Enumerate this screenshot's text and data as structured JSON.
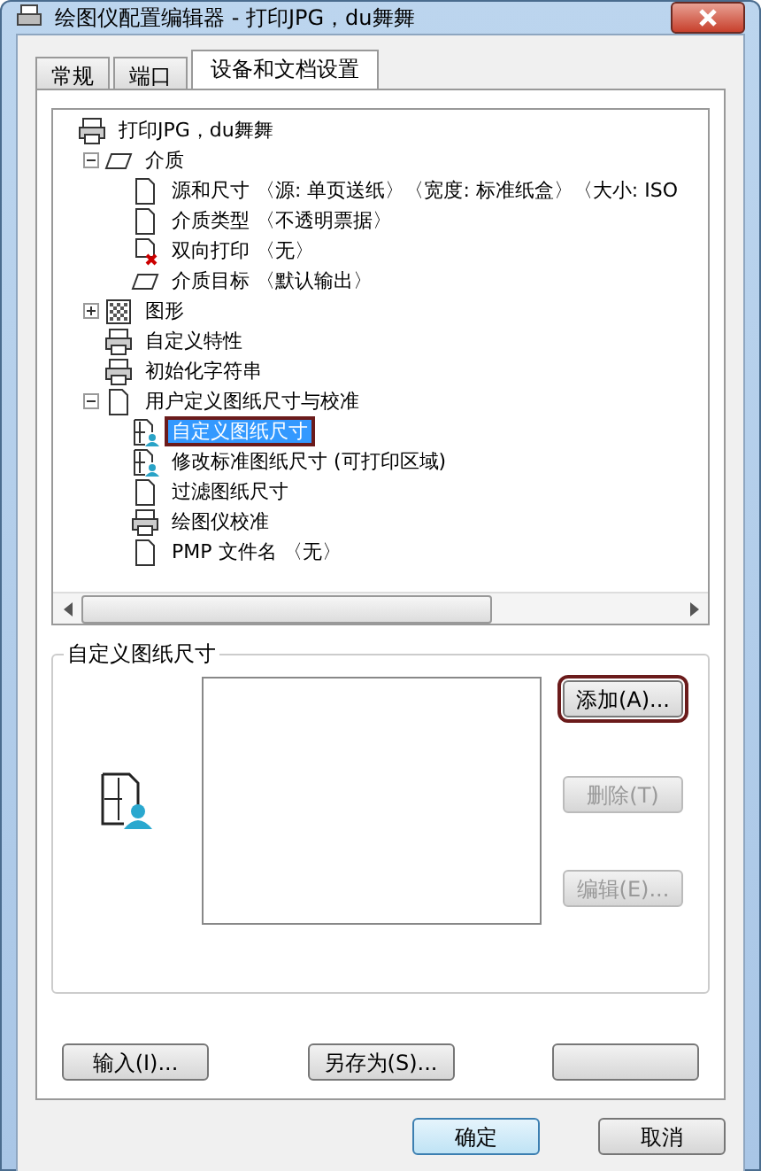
{
  "window": {
    "title": "绘图仪配置编辑器 - 打印JPG，du舞舞"
  },
  "tabs": [
    {
      "label": "常规",
      "selected": false
    },
    {
      "label": "端口",
      "selected": false
    },
    {
      "label": "设备和文档设置",
      "selected": true
    }
  ],
  "tree": [
    {
      "label": "打印JPG，du舞舞",
      "kind": "printer",
      "selected": false,
      "highlighted": false,
      "children": [
        {
          "label": "介质",
          "kind": "sheet",
          "expanded": true,
          "selected": false,
          "highlighted": false,
          "children": [
            {
              "label": "源和尺寸 〈源:  单页送纸〉〈宽度: 标准纸盒〉〈大小: ISO",
              "kind": "page",
              "selected": false,
              "highlighted": false
            },
            {
              "label": "介质类型 〈不透明票据〉",
              "kind": "page",
              "selected": false,
              "highlighted": false
            },
            {
              "label": "双向打印 〈无〉",
              "kind": "duplex",
              "selected": false,
              "highlighted": false
            },
            {
              "label": "介质目标 〈默认输出〉",
              "kind": "sheet",
              "selected": false,
              "highlighted": false
            }
          ]
        },
        {
          "label": "图形",
          "kind": "pattern",
          "expanded": false,
          "selected": false,
          "highlighted": false
        },
        {
          "label": "自定义特性",
          "kind": "printer",
          "selected": false,
          "highlighted": false
        },
        {
          "label": "初始化字符串",
          "kind": "printer",
          "selected": false,
          "highlighted": false
        },
        {
          "label": "用户定义图纸尺寸与校准",
          "kind": "page",
          "expanded": true,
          "selected": false,
          "highlighted": false,
          "children": [
            {
              "label": "自定义图纸尺寸",
              "kind": "size",
              "selected": true,
              "highlighted": true
            },
            {
              "label": "修改标准图纸尺寸 (可打印区域)",
              "kind": "size",
              "selected": false,
              "highlighted": false
            },
            {
              "label": "过滤图纸尺寸",
              "kind": "page",
              "selected": false,
              "highlighted": false
            },
            {
              "label": "绘图仪校准",
              "kind": "printer",
              "selected": false,
              "highlighted": false
            },
            {
              "label": "PMP 文件名 〈无〉",
              "kind": "page",
              "selected": false,
              "highlighted": false
            }
          ]
        }
      ]
    }
  ],
  "group": {
    "title": "自定义图纸尺寸",
    "buttons": [
      {
        "label": "添加(A)...",
        "disabled": false,
        "highlighted": true
      },
      {
        "label": "删除(T)",
        "disabled": true,
        "highlighted": false
      },
      {
        "label": "编辑(E)...",
        "disabled": true,
        "highlighted": false
      }
    ]
  },
  "panel_buttons": [
    {
      "kind": "text",
      "label": "输入(I)..."
    },
    {
      "kind": "text",
      "label": "另存为(S)..."
    },
    {
      "kind": "blank"
    }
  ],
  "dialog_buttons": [
    {
      "label": "确定",
      "default": true
    },
    {
      "label": "取消",
      "default": false
    }
  ]
}
